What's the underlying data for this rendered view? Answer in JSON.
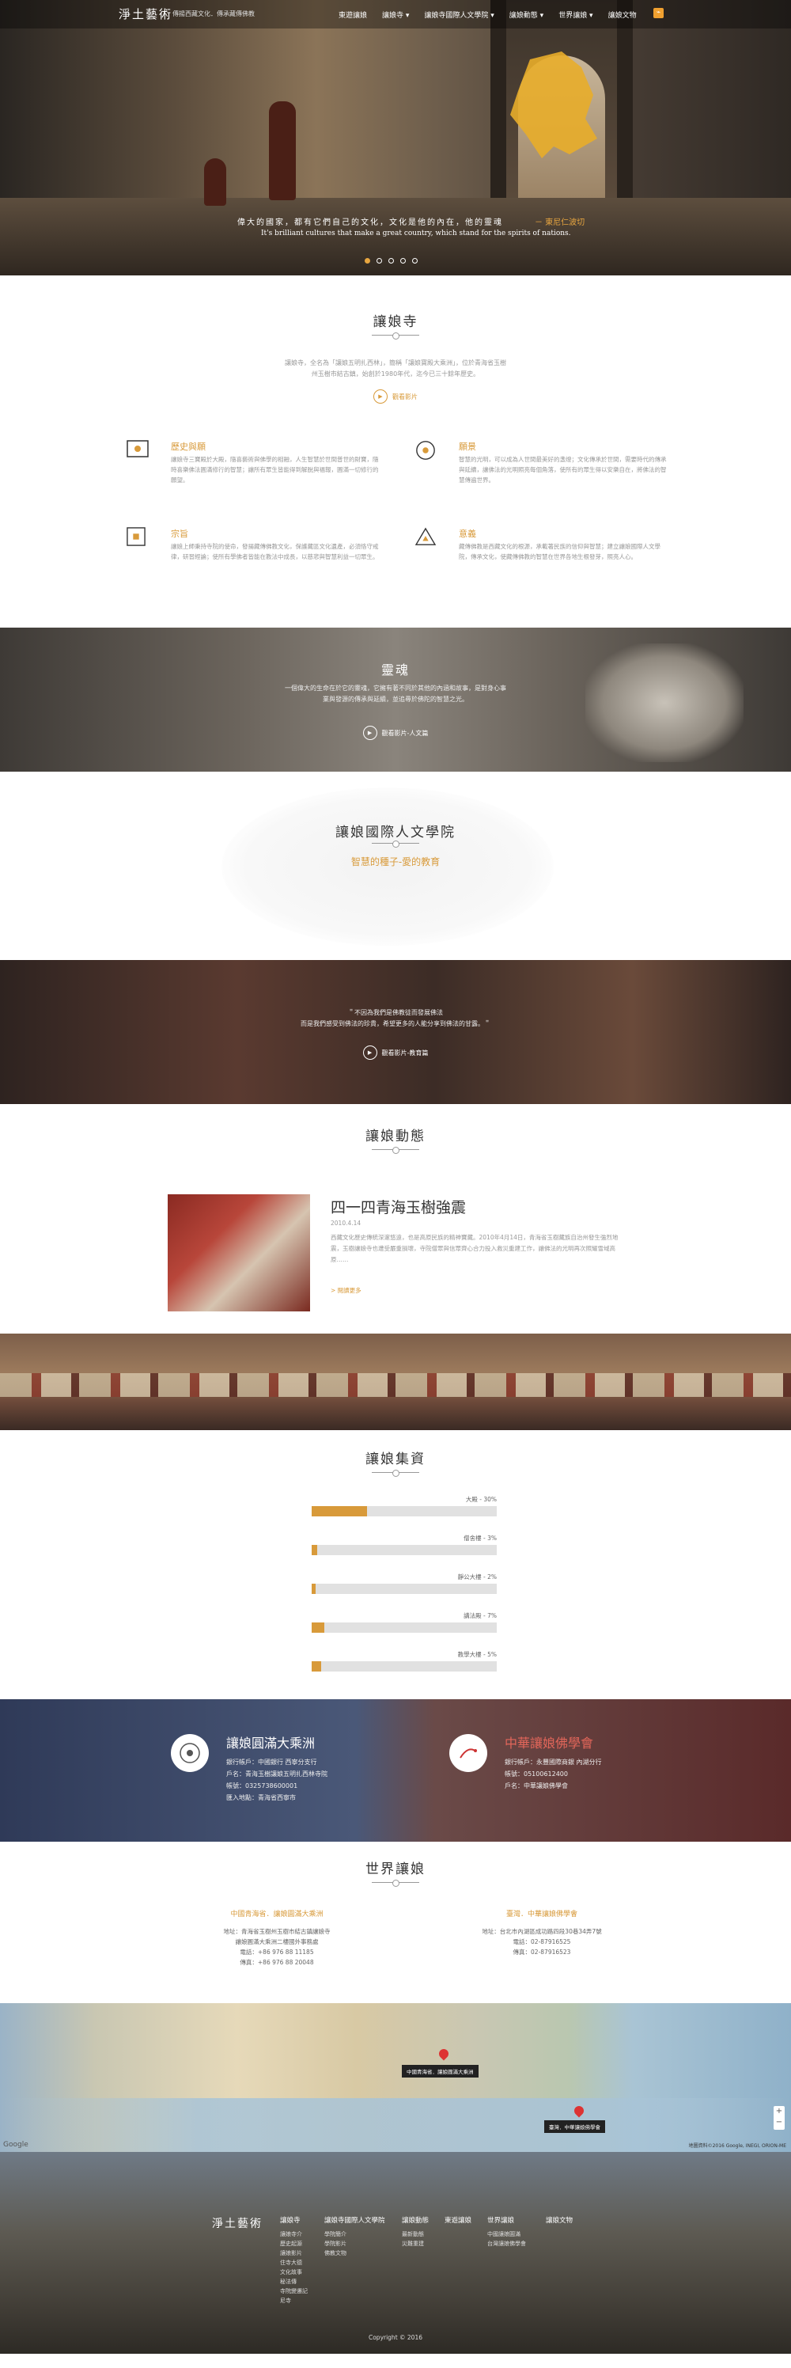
{
  "header": {
    "logo": "淨土藝術",
    "tagline": "傳揚西藏文化．傳承藏傳佛教",
    "nav": [
      "東遊讓娘",
      "讓娘寺 ▾",
      "讓娘寺國際人文學院 ▾",
      "讓娘動態 ▾",
      "世界讓娘 ▾",
      "讓娘文物"
    ],
    "rss_icon": "rss-icon"
  },
  "hero": {
    "quote_cn": "偉大的國家，都有它們自己的文化，文化是他的內在，他的靈魂",
    "quote_accent": "－ 東尼仁波切",
    "quote_en": "It's brilliant cultures that make a great country, which stand for the spirits of nations.",
    "slides": 5,
    "active_slide": 0
  },
  "intro": {
    "title": "讓娘寺",
    "text": "讓娘寺，全名為「讓娘五明扎西林」，簡稱「讓娘寶殿大乘洲」，位於青海省玉樹州玉樹市結古鎮，始創於1980年代，迄今已三十餘年歷史。",
    "video_label": "觀看影片",
    "features": [
      {
        "icon": "target-icon",
        "title": "歷史與願",
        "text": "讓娘寺三寶殿於大殿，隨喜藝術與佛學的相融，人生智慧於世間普世的財寶，隨時喜樂佛法圓滿修行的智慧；讓所有眾生皆能得到解脫與福報，圓滿一切修行的願望。"
      },
      {
        "icon": "circle-dot-icon",
        "title": "願景",
        "text": "智慧的光明，可以成為人世間最美好的盞燈；文化傳承於世間，需要時代的傳承與延續，讓佛法的光明照亮每個角落，使所有的眾生得以安樂自在，將佛法的智慧傳遍世界。"
      },
      {
        "icon": "square-dot-icon",
        "title": "宗旨",
        "text": "讓娘上師秉持寺院的使命，發揚藏傳佛教文化，保護藏區文化遺產，必須恪守戒律，研習經論；使所有學佛者皆能在教法中成長，以慈悲與智慧利益一切眾生。"
      },
      {
        "icon": "triangle-icon",
        "title": "意義",
        "text": "藏傳佛教是西藏文化的根源，承載著民族的信仰與智慧；建立讓娘國際人文學院，傳承文化，使藏傳佛教的智慧在世界各地生根發芽，照亮人心。"
      }
    ]
  },
  "soul": {
    "title": "靈魂",
    "text": "一個偉大的生命在於它的靈魂，它擁有著不同於其他的內涵和故事，是對身心事業與發源的傳承與延續，並追尋於佛陀的智慧之光。",
    "video_label": "觀看影片-人文篇"
  },
  "academy": {
    "title": "讓娘國際人文學院",
    "subtitle": "智慧的種子-愛的教育"
  },
  "teach": {
    "text1": "＂不因為我們是佛教徒而發展佛法",
    "text2": "而是我們感受到佛法的珍貴，希望更多的人能分享到佛法的甘露。＂",
    "video_label": "觀看影片-教育篇"
  },
  "news": {
    "title": "讓娘動態",
    "headline": "四一四青海玉樹強震",
    "date": "2010.4.14",
    "text": "西藏文化歷史傳統深邃悠遠，也是高原民族的精神寶藏。2010年4月14日，青海省玉樹藏族自治州發生強烈地震，玉樹讓娘寺也遭受嚴重損壞，寺院僧眾與信眾齊心合力投入救災重建工作，讓佛法的光明再次照耀雪域高原……",
    "more": "> 閱讀更多"
  },
  "funds": {
    "title": "讓娘集資",
    "bars": [
      {
        "label": "大殿 - 30%",
        "value": 30
      },
      {
        "label": "僧舍樓 - 3%",
        "value": 3
      },
      {
        "label": "靜公大樓 - 2%",
        "value": 2
      },
      {
        "label": "講法殿 - 7%",
        "value": 7
      },
      {
        "label": "教學大樓 - 5%",
        "value": 5
      }
    ]
  },
  "accounts": {
    "left": {
      "title": "讓娘圓滿大乘洲",
      "lines": [
        "銀行帳戶：中國銀行 西寧分支行",
        "戶名：青海玉樹讓娘五明扎西林寺院",
        "帳號：0325738600001",
        "匯入地點：青海省西寧市"
      ]
    },
    "right": {
      "title": "中華讓娘佛學會",
      "lines": [
        "銀行帳戶：永豐國際商銀 內湖分行",
        "帳號：05100612400",
        "戶名：中華讓娘佛學會"
      ]
    }
  },
  "world": {
    "title": "世界讓娘",
    "left": {
      "head": "中國青海省．讓娘圓滿大乘洲",
      "lines": [
        "地址：青海省玉樹州玉樹市結古鎮讓娘寺",
        "讓娘圓滿大乘洲二樓國外事務處",
        "電話：+86 976 88 11185",
        "傳真：+86 976 88 20048"
      ]
    },
    "right": {
      "head": "臺灣．中華讓娘佛學會",
      "lines": [
        "地址：台北市內湖區成功路四段30巷34弄7號",
        "電話：02-87916525",
        "傳真：02-87916523"
      ]
    }
  },
  "map": {
    "pin1": "中國青海省．讓娘圓滿大乘洲",
    "pin2": "臺灣．中華讓娘佛學會",
    "credit": "地圖資料©2016 Google, INEGI, ORION-ME",
    "google": "Google"
  },
  "footer": {
    "logo": "淨土藝術",
    "columns": [
      {
        "head": "讓娘寺",
        "items": [
          "讓娘寺介",
          "歷史起源",
          "讓娘影片",
          "住寺大德",
          "文化故事",
          "秘法傳",
          "寺院變遷記",
          "尼寺"
        ]
      },
      {
        "head": "讓娘寺國際人文學院",
        "items": [
          "學院簡介",
          "學院影片",
          "佛教文物"
        ]
      },
      {
        "head": "讓娘動態",
        "items": [
          "最新動態",
          "災難重建"
        ]
      },
      {
        "head": "東遊讓娘",
        "items": []
      },
      {
        "head": "世界讓娘",
        "items": [
          "中國讓娘圓滿",
          "台灣讓娘佛學會"
        ]
      },
      {
        "head": "讓娘文物",
        "items": []
      }
    ],
    "copyright": "Copyright © 2016"
  },
  "colors": {
    "accent": "#d89a3a",
    "bar_track": "#e1e1e1"
  }
}
